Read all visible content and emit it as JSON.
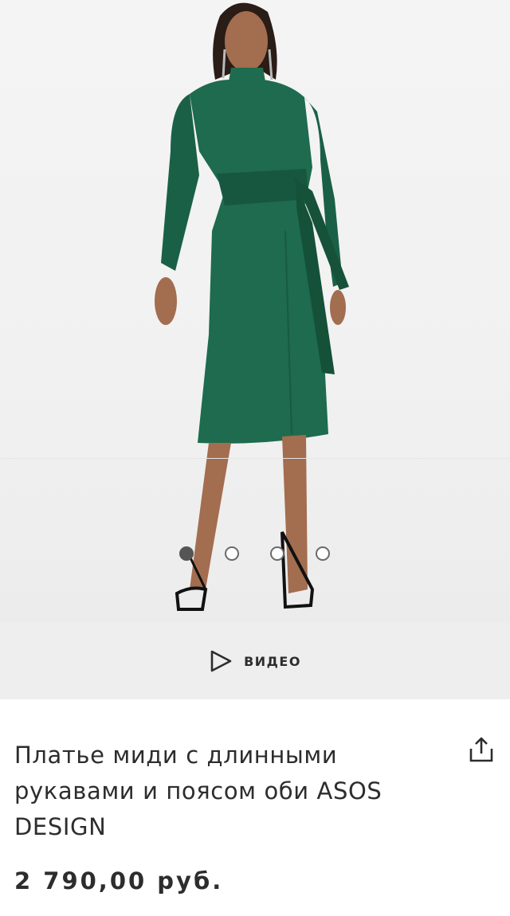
{
  "gallery": {
    "image_alt": "Платье миди с длинными рукавами и поясом оби ASOS DESIGN",
    "dots": [
      {
        "active": true
      },
      {
        "active": false
      },
      {
        "active": false
      },
      {
        "active": false
      }
    ]
  },
  "video": {
    "label": "ВИДЕО",
    "icon": "play-icon"
  },
  "product": {
    "title": "Платье миди с длинными рукавами и поясом оби ASOS DESIGN",
    "price": "2 790,00 руб.",
    "share_icon": "share-icon",
    "dress_color": "#1e6b4f"
  },
  "colors": {
    "text": "#2d2d2d",
    "video_bar_bg": "#eeeeee",
    "image_bg": "#f2f2f2"
  }
}
